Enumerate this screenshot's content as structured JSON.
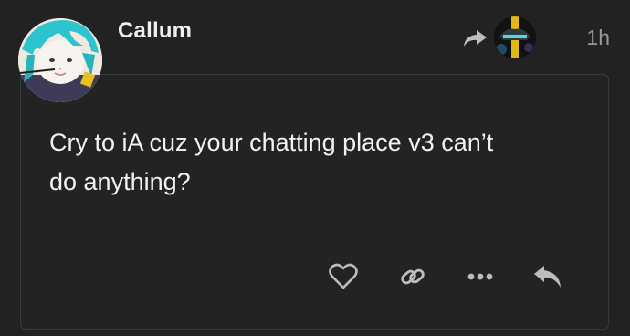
{
  "post": {
    "username": "Callum",
    "timestamp": "1h",
    "body_lines": [
      "Cry to iA cuz your chatting place v3 can’t",
      "do anything?"
    ]
  },
  "icons": {
    "share": "share-arrow-icon",
    "like": "heart-icon",
    "copy_link": "link-icon",
    "more": "ellipsis-icon",
    "reply": "reply-icon"
  },
  "colors": {
    "background": "#222222",
    "card_border": "#3a3a3a",
    "text": "#f2f2f2",
    "muted": "#9a9a9a",
    "icon": "#bdbdbd",
    "avatar_hair": "#2ec4cf"
  }
}
